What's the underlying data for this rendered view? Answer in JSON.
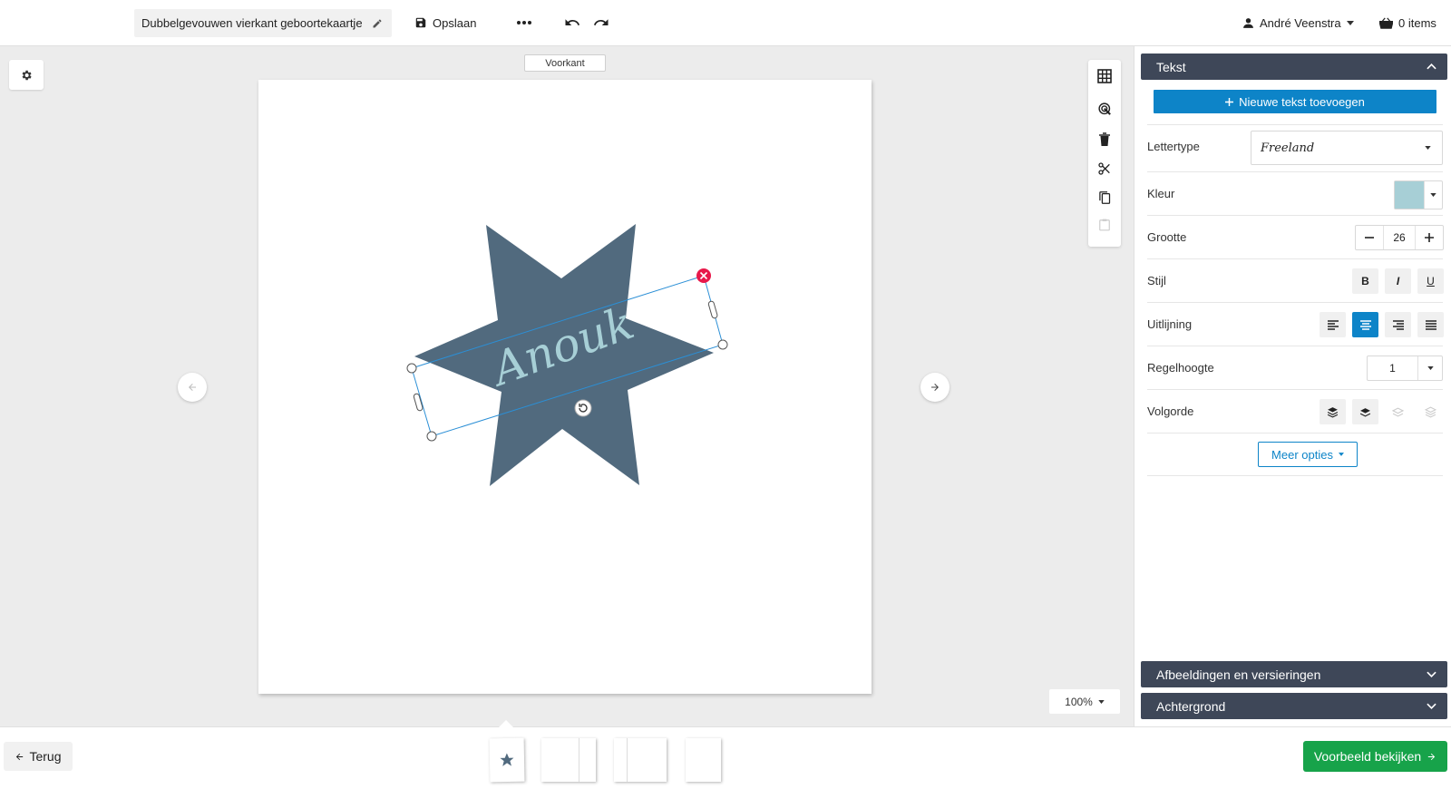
{
  "toolbar": {
    "document_title": "Dubbelgevouwen vierkant geboortekaartje",
    "save_label": "Opslaan",
    "user_name": "André Veenstra",
    "cart_label": "0 items"
  },
  "canvas": {
    "side_label": "Voorkant",
    "text_content": "Anouk",
    "shape_color": "#516a7e",
    "text_color": "#a7cfd6",
    "zoom": "100%"
  },
  "panel": {
    "text_section": {
      "title": "Tekst",
      "add_button": "Nieuwe tekst toevoegen",
      "font_label": "Lettertype",
      "font_value": "Freeland",
      "color_label": "Kleur",
      "color_value": "#a7cfd6",
      "size_label": "Grootte",
      "size_value": "26",
      "style_label": "Stijl",
      "style_bold": "B",
      "style_italic": "I",
      "style_underline": "U",
      "align_label": "Uitlijning",
      "align_active": "center",
      "line_height_label": "Regelhoogte",
      "line_height_value": "1",
      "order_label": "Volgorde",
      "more_options": "Meer opties"
    },
    "images_section": {
      "title": "Afbeeldingen en versieringen"
    },
    "background_section": {
      "title": "Achtergrond"
    }
  },
  "bottombar": {
    "back_label": "Terug",
    "preview_label": "Voorbeeld bekijken"
  },
  "colors": {
    "accent": "#0d84c8",
    "header": "#3e4758",
    "success": "#17a34a",
    "delete_handle": "#e8184a"
  },
  "icons": [
    "pencil-icon",
    "save-icon",
    "more-icon",
    "undo-icon",
    "redo-icon",
    "user-icon",
    "cart-icon",
    "gear-icon",
    "grid-icon",
    "touch-icon",
    "trash-icon",
    "scissors-icon",
    "copy-icon",
    "paste-icon",
    "arrow-left-icon",
    "arrow-right-icon",
    "chevron-up-icon",
    "chevron-down-icon",
    "plus-icon",
    "minus-icon",
    "align-left-icon",
    "align-center-icon",
    "align-right-icon",
    "align-justify-icon",
    "layer-front-icon",
    "layer-forward-icon",
    "layer-backward-icon",
    "layer-back-icon",
    "star-icon"
  ]
}
